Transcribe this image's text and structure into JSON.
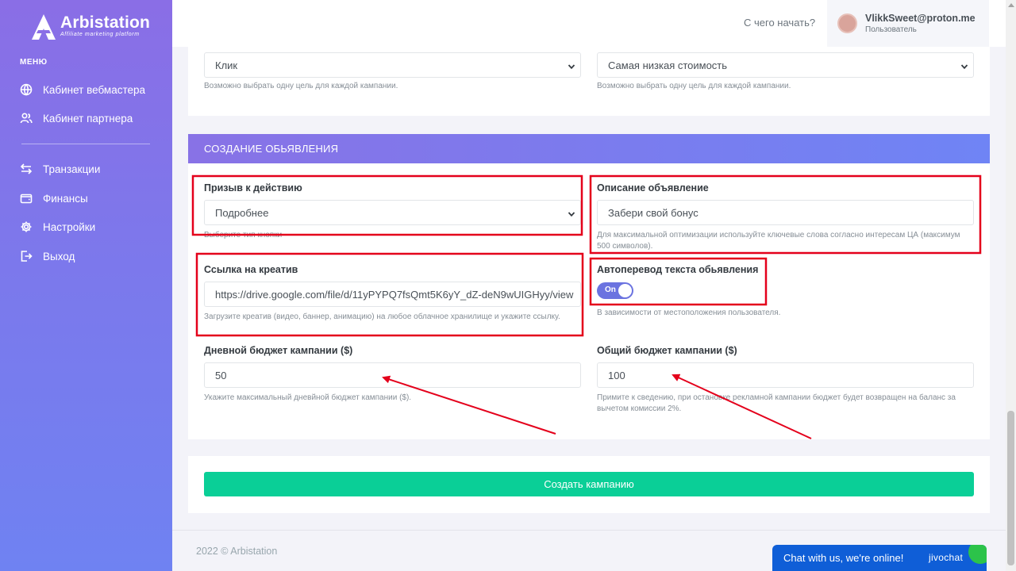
{
  "brand": {
    "name": "Arbistation",
    "tagline": "Affiliate marketing platform"
  },
  "sidebar": {
    "caption": "МЕНЮ",
    "items": [
      {
        "label": "Кабинет вебмастера",
        "icon": "globe-icon"
      },
      {
        "label": "Кабинет партнера",
        "icon": "users-icon"
      },
      {
        "label": "Транзакции",
        "icon": "arrows-icon"
      },
      {
        "label": "Финансы",
        "icon": "wallet-icon"
      },
      {
        "label": "Настройки",
        "icon": "gear-icon"
      },
      {
        "label": "Выход",
        "icon": "logout-icon"
      }
    ]
  },
  "header": {
    "help_link": "С чего начать?",
    "user": {
      "email": "VlikkSweet@proton.me",
      "role": "Пользователь"
    }
  },
  "goal_section": {
    "goal_select": "Клик",
    "goal_hint": "Возможно выбрать одну цель для каждой кампании.",
    "strategy_select": "Самая низкая стоимость",
    "strategy_hint": "Возможно выбрать одну цель для каждой кампании."
  },
  "ad_section": {
    "title": "СОЗДАНИЕ ОБЬЯВЛЕНИЯ",
    "cta": {
      "label": "Призыв к действию",
      "value": "Подробнее",
      "hint": "Выберите тип кнопки"
    },
    "description": {
      "label": "Описание объявление",
      "value": "Забери свой бонус",
      "hint": "Для максимальной оптимизации используйте ключевые слова согласно интересам ЦА (максимум 500 символов)."
    },
    "creative": {
      "label": "Ссылка на креатив",
      "value": "https://drive.google.com/file/d/11yPYPQ7fsQmt5K6yY_dZ-deN9wUIGHyy/view",
      "hint": "Загрузите креатив (видео, баннер, анимацию) на любое облачное хранилище и укажите ссылку."
    },
    "autotranslate": {
      "label": "Автоперевод текста обьявления",
      "toggle_label": "On",
      "enabled": true,
      "hint": "В зависимости от местоположения пользователя."
    },
    "daily_budget": {
      "label": "Дневной бюджет кампании ($)",
      "value": "50",
      "hint": "Укажите максимальный дневйной бюджет кампании ($)."
    },
    "total_budget": {
      "label": "Общий бюджет кампании ($)",
      "value": "100",
      "hint": "Примите к сведению, при остановке рекламной кампании бюджет будет возвращен на баланс за вычетом комиссии 2%."
    }
  },
  "actions": {
    "create_label": "Создать кампанию"
  },
  "footer": {
    "copyright": "2022 © Arbistation"
  },
  "chat": {
    "text": "Chat with us, we're online!",
    "brand": "jivochat"
  },
  "colors": {
    "accent": "#7b79ec",
    "success": "#0acf97",
    "annotation": "#e4001b",
    "chat": "#0f5ed7"
  }
}
